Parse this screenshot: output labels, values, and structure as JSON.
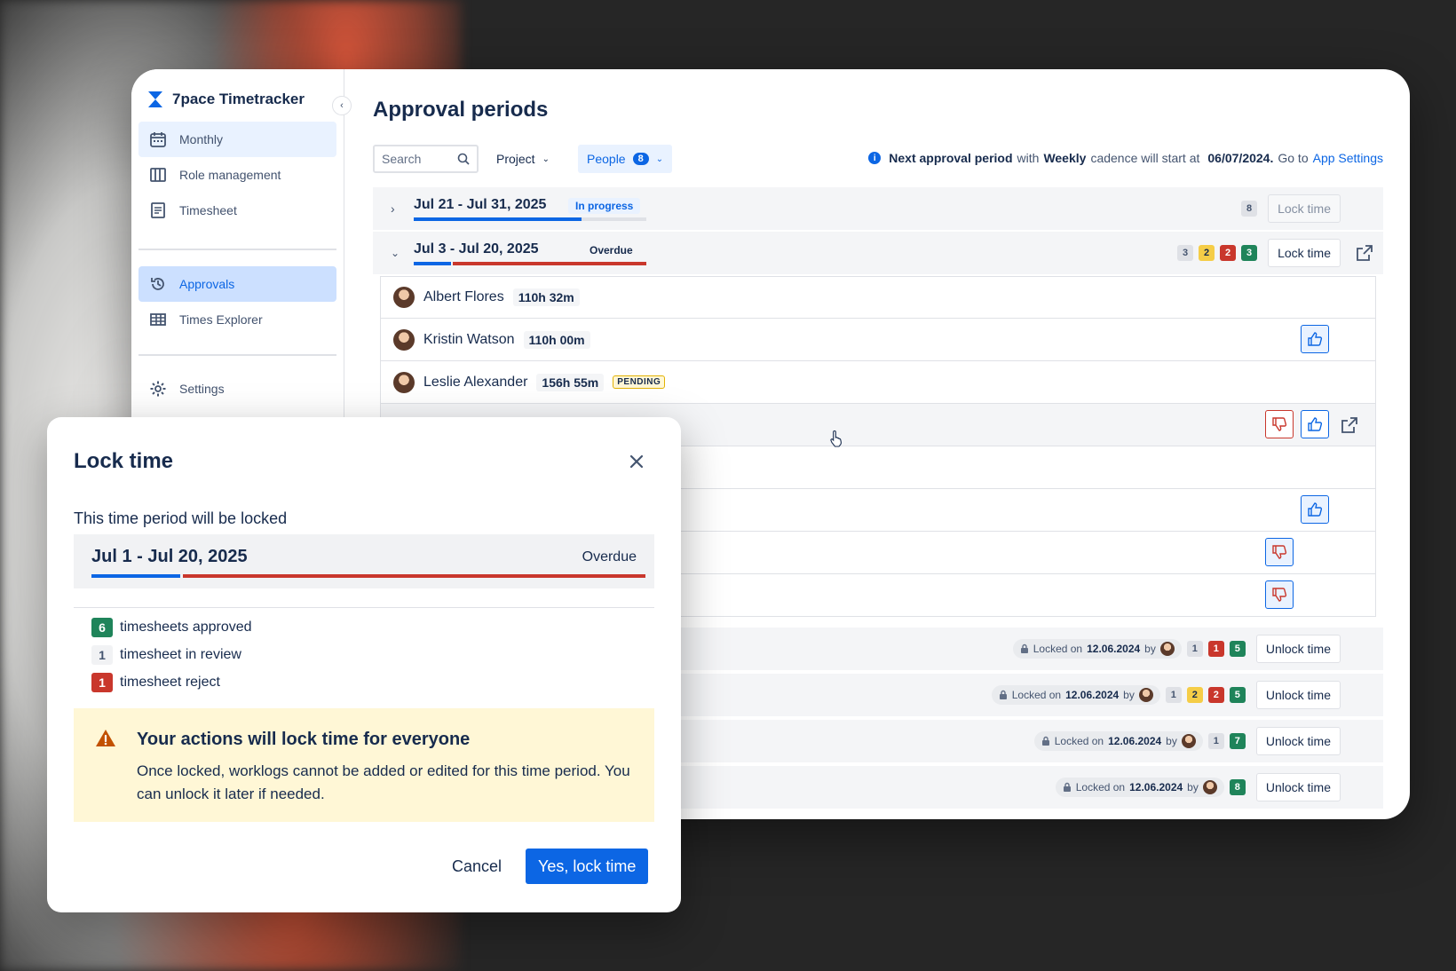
{
  "app": {
    "brand": "7pace Timetracker"
  },
  "sidebar": {
    "items": [
      {
        "label": "Monthly",
        "icon": "calendar-icon"
      },
      {
        "label": "Role management",
        "icon": "columns-icon"
      },
      {
        "label": "Timesheet",
        "icon": "document-icon"
      },
      {
        "label": "Approvals",
        "icon": "history-icon"
      },
      {
        "label": "Times Explorer",
        "icon": "table-icon"
      },
      {
        "label": "Settings",
        "icon": "gear-icon"
      }
    ]
  },
  "page": {
    "title": "Approval periods"
  },
  "toolbar": {
    "search_placeholder": "Search",
    "project_label": "Project",
    "people_label": "People",
    "people_count": "8"
  },
  "info": {
    "part1": "Next approval period",
    "part2": "with",
    "cadence": "Weekly",
    "part3": "cadence will start at",
    "date": "06/07/2024.",
    "part4": "Go to",
    "link": "App Settings"
  },
  "periods": [
    {
      "name": "Jul 21 - Jul 31, 2025",
      "status": "In progress",
      "count": "8",
      "action": "Lock time",
      "progress_approved": 0.72
    },
    {
      "name": "Jul 3 - Jul 20, 2025",
      "status": "Overdue",
      "counts": [
        "3",
        "2",
        "2",
        "3"
      ],
      "action": "Lock time",
      "progress_approved": 0.16
    }
  ],
  "people": [
    {
      "name": "Albert Flores",
      "hours": "110h 32m"
    },
    {
      "name": "Kristin Watson",
      "hours": "110h 00m"
    },
    {
      "name": "Leslie Alexander",
      "hours": "156h 55m",
      "badge": "PENDING"
    }
  ],
  "locked_periods": [
    {
      "chip_prefix": "Locked on",
      "date": "12.06.2024",
      "by": "by",
      "counts": [
        "1",
        "1",
        "5"
      ],
      "action": "Unlock time"
    },
    {
      "chip_prefix": "Locked on",
      "date": "12.06.2024",
      "by": "by",
      "counts": [
        "1",
        "2",
        "2",
        "5"
      ],
      "action": "Unlock time"
    },
    {
      "chip_prefix": "Locked on",
      "date": "12.06.2024",
      "by": "by",
      "counts": [
        "1",
        "7"
      ],
      "action": "Unlock time"
    },
    {
      "chip_prefix": "Locked on",
      "date": "12.06.2024",
      "by": "by",
      "counts": [
        "8"
      ],
      "action": "Unlock time"
    }
  ],
  "modal": {
    "title": "Lock time",
    "subtitle": "This time period will be locked",
    "period_name": "Jul 1 - Jul 20, 2025",
    "period_status": "Overdue",
    "progress_approved": 0.16,
    "stats": [
      {
        "count": "6",
        "label": "timesheets approved"
      },
      {
        "count": "1",
        "label": "timesheet in review"
      },
      {
        "count": "1",
        "label": "timesheet reject"
      }
    ],
    "warning_title": "Your actions will lock time for everyone",
    "warning_body": "Once locked, worklogs cannot be added or edited for this time period. You can unlock it later if needed.",
    "cancel_label": "Cancel",
    "confirm_label": "Yes, lock time"
  },
  "colors": {
    "primary": "#0c66e4",
    "approved": "#1f845a",
    "rejected": "#c9372c",
    "pending": "#f5cd47",
    "warning_bg": "#fff7d6"
  }
}
